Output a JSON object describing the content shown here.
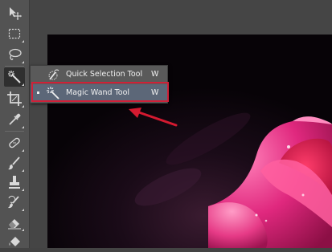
{
  "flyout": {
    "items": [
      {
        "label": "Quick Selection Tool",
        "shortcut": "W",
        "icon": "quick-selection-icon",
        "selected": false
      },
      {
        "label": "Magic Wand Tool",
        "shortcut": "W",
        "icon": "magic-wand-icon",
        "selected": true
      }
    ]
  },
  "toolbar": {
    "tools": [
      "move-icon",
      "rectangular-marquee-icon",
      "lasso-icon",
      "magic-wand-icon",
      "crop-icon",
      "eyedropper-icon",
      "spot-healing-brush-icon",
      "brush-icon",
      "clone-stamp-icon",
      "history-brush-icon",
      "eraser-icon",
      "paint-bucket-icon"
    ],
    "active": "magic-wand-icon"
  },
  "annotation": {
    "highlight_color": "#d02038"
  }
}
